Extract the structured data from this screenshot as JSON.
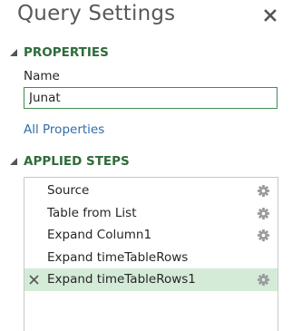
{
  "panel": {
    "title": "Query Settings"
  },
  "properties": {
    "header": "PROPERTIES",
    "name_label": "Name",
    "name_value": "Junat",
    "all_properties_link": "All Properties"
  },
  "applied_steps": {
    "header": "APPLIED STEPS",
    "steps": [
      {
        "label": "Source",
        "has_settings": true,
        "selected": false
      },
      {
        "label": "Table from List",
        "has_settings": true,
        "selected": false
      },
      {
        "label": "Expand Column1",
        "has_settings": true,
        "selected": false
      },
      {
        "label": "Expand timeTableRows",
        "has_settings": false,
        "selected": false
      },
      {
        "label": "Expand timeTableRows1",
        "has_settings": true,
        "selected": true
      }
    ]
  },
  "colors": {
    "accent_green": "#2f6b3a",
    "selected_row": "#d4ebd8",
    "link_blue": "#2e6ea8",
    "input_border": "#3e8e51"
  },
  "icons": {
    "close": "close-icon",
    "collapse": "collapse-triangle-icon",
    "settings": "gear-icon",
    "delete_step": "delete-step-icon"
  }
}
